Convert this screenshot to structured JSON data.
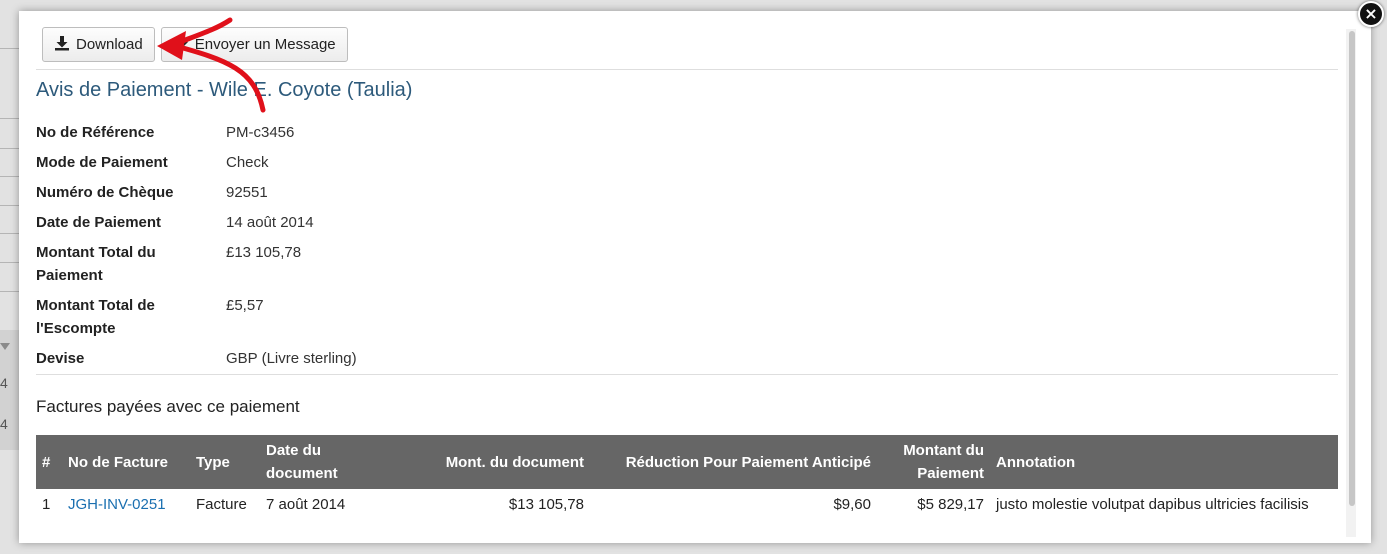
{
  "toolbar": {
    "download_label": "Download",
    "message_label": "Envoyer un Message"
  },
  "title": "Avis de Paiement - Wile E. Coyote (Taulia)",
  "details": [
    {
      "label": "No de Référence",
      "value": "PM-c3456"
    },
    {
      "label": "Mode de Paiement",
      "value": "Check"
    },
    {
      "label": "Numéro de Chèque",
      "value": "92551"
    },
    {
      "label": "Date de Paiement",
      "value": "14 août 2014"
    },
    {
      "label": "Montant Total du Paiement",
      "value": "£13 105,78"
    },
    {
      "label": "Montant Total de l'Escompte",
      "value": "£5,57"
    },
    {
      "label": "Devise",
      "value": "GBP (Livre sterling)"
    }
  ],
  "invoices_title": "Factures payées avec ce paiement",
  "table": {
    "headers": [
      "#",
      "No de Facture",
      "Type",
      "Date du document",
      "Mont. du document",
      "Réduction Pour Paiement Anticipé",
      "Montant du Paiement",
      "Annotation"
    ],
    "rows": [
      [
        "1",
        "JGH-INV-0251",
        "Facture",
        "7 août 2014",
        "$13 105,78",
        "$9,60",
        "$5 829,17",
        "justo molestie volutpat dapibus ultricies facilisis"
      ]
    ]
  },
  "background": {
    "chars": [
      "4",
      "4"
    ]
  },
  "icons": {
    "download": "download-icon",
    "message": "share-arrow-icon",
    "close": "close-icon"
  },
  "colors": {
    "title": "#2d5a7b",
    "link": "#1a6fb0",
    "table_header": "#666666",
    "annotation_arrow": "#e0101a"
  }
}
